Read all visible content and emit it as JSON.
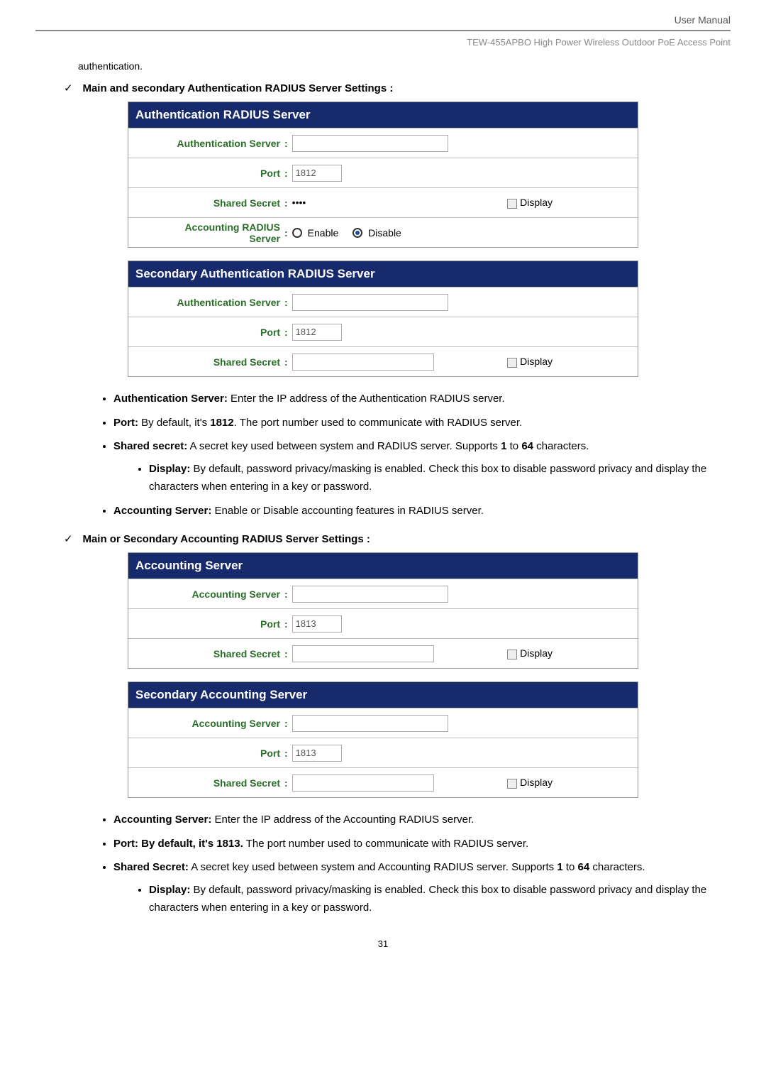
{
  "header": {
    "user_manual": "User Manual",
    "product": "TEW-455APBO High Power Wireless Outdoor PoE Access Point"
  },
  "intro_word": "authentication.",
  "sections": {
    "auth_heading": "Main and secondary Authentication RADIUS Server Settings :",
    "acct_heading": "Main or Secondary Accounting RADIUS Server Settings :"
  },
  "labels": {
    "auth_server": "Authentication Server",
    "port": "Port",
    "shared_secret": "Shared Secret",
    "acct_radius": "Accounting RADIUS",
    "server_word": "Server",
    "enable": "Enable",
    "disable": "Disable",
    "display": "Display",
    "accounting_server": "Accounting Server"
  },
  "panels": {
    "auth_title": "Authentication RADIUS Server",
    "auth_port": "1812",
    "auth_secret_mask": "••••",
    "sec_auth_title": "Secondary Authentication RADIUS Server",
    "sec_auth_port": "1812",
    "acct_title": "Accounting Server",
    "acct_port": "1813",
    "sec_acct_title": "Secondary Accounting Server",
    "sec_acct_port": "1813"
  },
  "bullets_auth": {
    "b1_label": "Authentication Server:",
    "b1_text": " Enter the IP address of the Authentication RADIUS server.",
    "b2_label": "Port:",
    "b2_text_a": " By default, it's ",
    "b2_bold": "1812",
    "b2_text_b": ". The port number used to communicate with RADIUS server.",
    "b3_label": "Shared secret:",
    "b3_text_a": " A secret key used between system and RADIUS server. Supports ",
    "b3_n1": "1",
    "b3_to": " to ",
    "b3_n2": "64",
    "b3_text_b": " characters.",
    "b3s_label": "Display:",
    "b3s_text": " By default, password privacy/masking is enabled. Check this box to disable password privacy and display the characters when entering in a key or password.",
    "b4_label": "Accounting Server:",
    "b4_text": " Enable or Disable accounting features in RADIUS server."
  },
  "bullets_acct": {
    "b1_label": "Accounting Server:",
    "b1_text": " Enter the IP address of the Accounting RADIUS server.",
    "b2_label": "Port: By default, it's 1813.",
    "b2_text": " The port number used to communicate with RADIUS server.",
    "b3_label": "Shared Secret:",
    "b3_text_a": " A secret key used between system and Accounting RADIUS server. Supports ",
    "b3_n1": "1",
    "b3_to": " to ",
    "b3_n2": "64",
    "b3_text_b": " characters.",
    "b3s_label": "Display:",
    "b3s_text": " By default, password privacy/masking is enabled. Check this box to disable password privacy and display the characters when entering in a key or password."
  },
  "page_number": "31"
}
